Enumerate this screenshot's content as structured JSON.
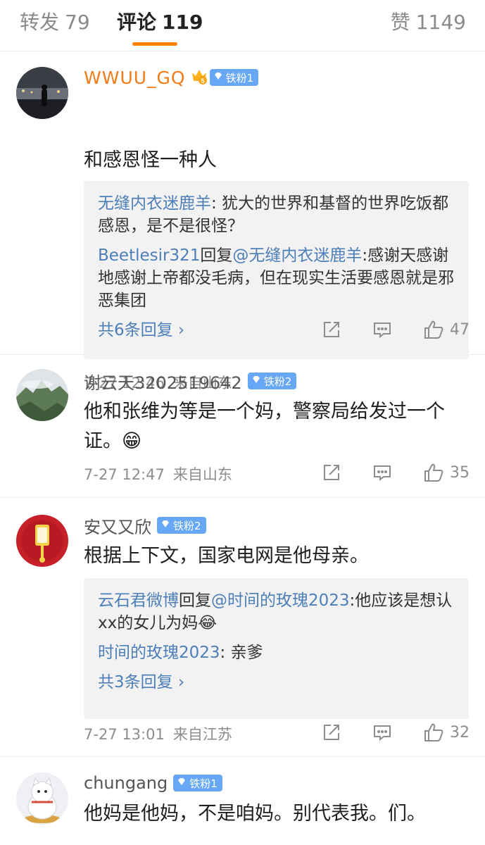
{
  "tabs": {
    "repost": {
      "label": "转发",
      "count": "79"
    },
    "comments": {
      "label": "评论",
      "count": "119"
    },
    "likes": {
      "label": "赞",
      "count": "1149"
    }
  },
  "colors": {
    "accent": "#ff8200",
    "link": "#4c7fb9",
    "badge": "#66a8f5",
    "vip_name": "#f07b18"
  },
  "comments": [
    {
      "name": "WWUU_GQ",
      "crown_level": "5",
      "badge": "铁粉1",
      "text": "和感恩怪一种人",
      "replies": [
        {
          "user": "无缝内衣迷鹿羊",
          "sep": ": ",
          "body": "犹大的世界和基督的世界吃饭都感恩，是不是很怪？"
        },
        {
          "user": "Beetlesir321",
          "mid": "回复",
          "mention": "@无缝内衣迷鹿羊",
          "body": ":感谢天感谢地感谢上帝都没毛病，但在现实生活要感恩就是邪恶集团"
        }
      ],
      "more": "共6条回复 ›",
      "time": "7-27 12:46",
      "source": "来自山东",
      "likes": "47"
    },
    {
      "name": "谢云天3202519642",
      "badge": "铁粉2",
      "text": "他和张维为等是一个妈，警察局给发过一个证。😁",
      "time": "7-27 12:47",
      "source": "来自山东",
      "likes": "35"
    },
    {
      "name": "安又又欣",
      "badge": "铁粉2",
      "text": "根据上下文，国家电网是他母亲。",
      "replies": [
        {
          "user": "云石君微博",
          "mid": "回复",
          "mention": "@时间的玫瑰2023",
          "body": ":他应该是想认xx的女儿为妈😂"
        },
        {
          "user": "时间的玫瑰2023",
          "sep": ": ",
          "body": "亲爹"
        }
      ],
      "more": "共3条回复 ›",
      "time": "7-27 13:01",
      "source": "来自江苏",
      "likes": "32"
    },
    {
      "name": "chungang",
      "badge": "铁粉1",
      "text": "他妈是他妈，不是咱妈。别代表我。们。"
    }
  ],
  "icons": [
    "crown-icon",
    "diamond-icon",
    "share-icon",
    "comment-icon",
    "thumb-up-icon",
    "chevron-right-icon"
  ]
}
